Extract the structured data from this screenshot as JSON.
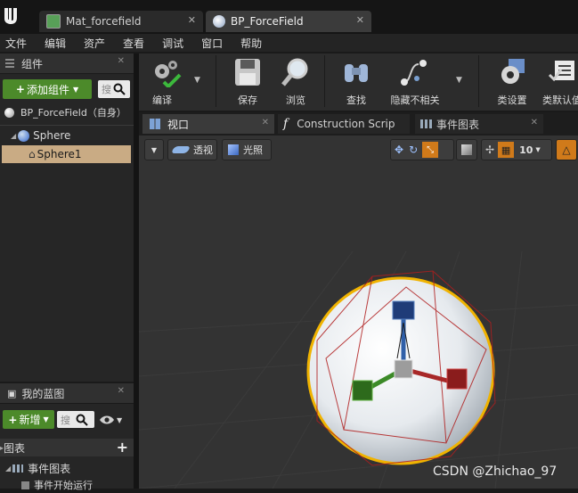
{
  "app": {
    "logo": "unreal-logo-icon"
  },
  "doc_tabs": [
    {
      "label": "Mat_forcefield",
      "icon": "material-doc-icon",
      "close": "✕"
    },
    {
      "label": "BP_ForceField",
      "icon": "blueprint-doc-icon",
      "close": "✕"
    }
  ],
  "menu": [
    "文件",
    "编辑",
    "资产",
    "查看",
    "调试",
    "窗口",
    "帮助"
  ],
  "components_panel": {
    "title": "组件",
    "add_label": "添加组件",
    "search_placeholder": "搜",
    "root_label": "BP_ForceField（自身）",
    "tree": [
      {
        "label": "Sphere"
      },
      {
        "label": "Sphere1"
      }
    ]
  },
  "toolbar": {
    "compile": "编译",
    "save": "保存",
    "browse": "浏览",
    "find": "查找",
    "hide_unrelated": "隐藏不相关",
    "class_settings": "类设置",
    "class_defaults": "类默认值"
  },
  "editor_tabs": [
    {
      "label": "视口",
      "icon": "viewport-icon"
    },
    {
      "label": "Construction Scrip",
      "icon": "function-icon"
    },
    {
      "label": "事件图表",
      "icon": "graph-icon"
    }
  ],
  "viewport": {
    "perspective": "透视",
    "lit": "光照",
    "grid_size": "10",
    "watermark": "CSDN @Zhichao_97"
  },
  "my_blueprint": {
    "title": "我的蓝图",
    "new_label": "新增",
    "search_placeholder": "搜",
    "section": "图表",
    "items": [
      "事件图表",
      "事件开始运行"
    ]
  },
  "colors": {
    "accent_green": "#4c8a2a",
    "selected_row": "#c9ab84",
    "gizmo_orange": "#f0b300"
  }
}
